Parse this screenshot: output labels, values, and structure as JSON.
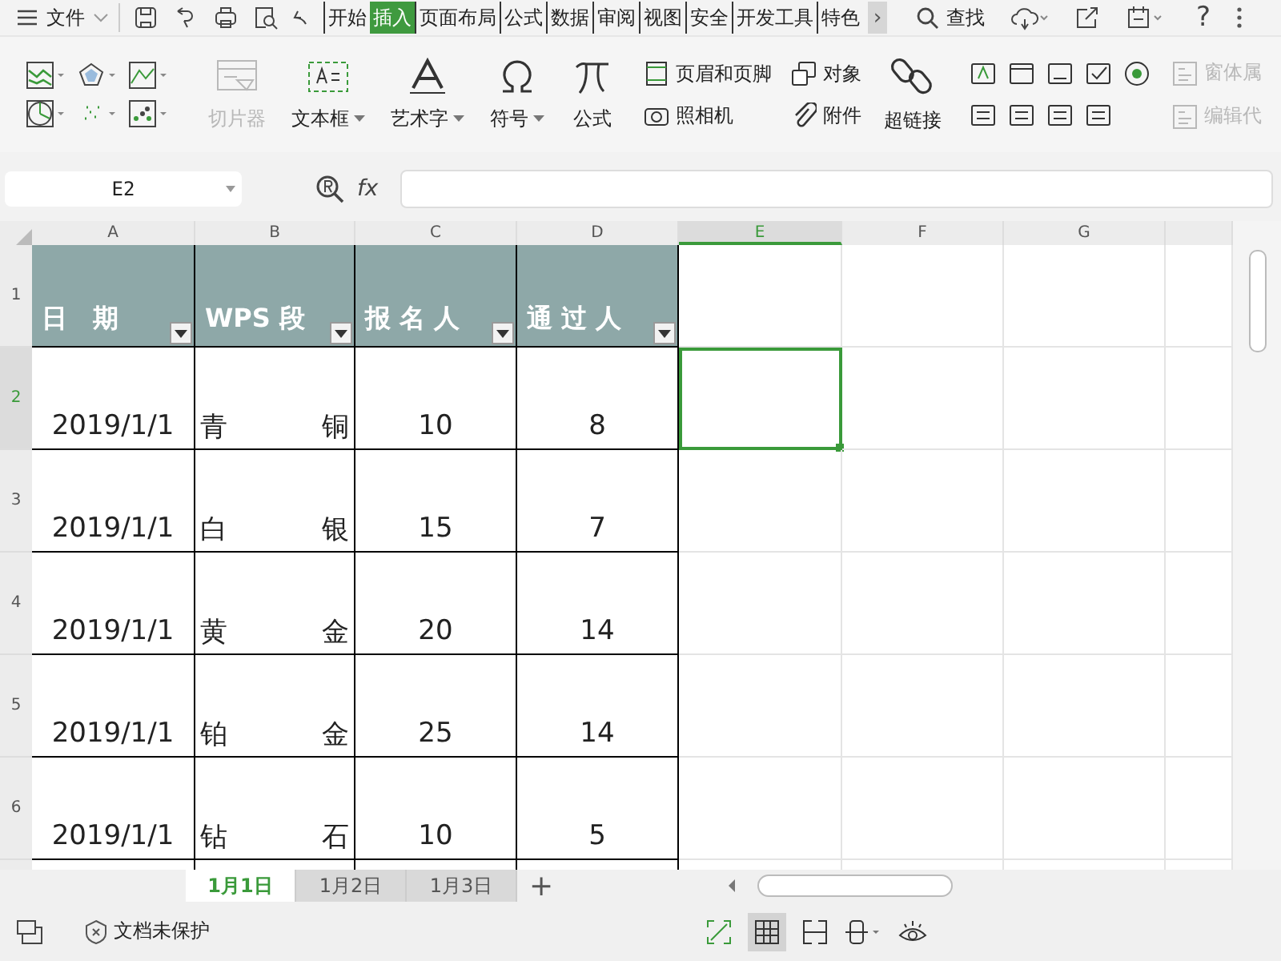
{
  "menu_bar": {
    "file_menu": "文件",
    "tabs": [
      {
        "label": "开始",
        "selected": false
      },
      {
        "label": "插入",
        "selected": true
      },
      {
        "label": "页面布局",
        "selected": false
      },
      {
        "label": "公式",
        "selected": false
      },
      {
        "label": "数据",
        "selected": false
      },
      {
        "label": "审阅",
        "selected": false
      },
      {
        "label": "视图",
        "selected": false
      },
      {
        "label": "安全",
        "selected": false
      },
      {
        "label": "开发工具",
        "selected": false
      },
      {
        "label": "特色",
        "selected": false
      }
    ],
    "more": "›",
    "search": "查找",
    "help": "?"
  },
  "ribbon": {
    "slicer": {
      "label": "切片器",
      "disabled": true
    },
    "insert_buttons": [
      {
        "label": "文本框",
        "dropdown": true
      },
      {
        "label": "艺术字",
        "dropdown": true
      },
      {
        "label": "符号",
        "dropdown": true
      },
      {
        "label": "公式",
        "dropdown": false
      }
    ],
    "small_buttons": [
      {
        "label": "页眉和页脚"
      },
      {
        "label": "照相机"
      },
      {
        "label": "对象"
      },
      {
        "label": "附件"
      }
    ],
    "hyperlink": "超链接",
    "control_buttons": [
      {
        "label": "窗体属",
        "disabled": true
      },
      {
        "label": "编辑代",
        "disabled": true
      }
    ]
  },
  "formula_bar": {
    "name_box": "E2",
    "function_label": "fx"
  },
  "sheet": {
    "columns": [
      {
        "label": "A",
        "selected": false
      },
      {
        "label": "B",
        "selected": false
      },
      {
        "label": "C",
        "selected": false
      },
      {
        "label": "D",
        "selected": false
      },
      {
        "label": "E",
        "selected": true
      },
      {
        "label": "F",
        "selected": false
      },
      {
        "label": "G",
        "selected": false
      }
    ],
    "rows": [
      {
        "number": "1",
        "selected": false,
        "cells": [
          {
            "text": "日　期",
            "filter": true
          },
          {
            "text": "WPS 段",
            "filter": true
          },
          {
            "text": "报 名 人",
            "filter": true
          },
          {
            "text": "通 过 人",
            "filter": true
          }
        ]
      },
      {
        "number": "2",
        "selected": true,
        "cells": [
          {
            "text": "2019/1/1",
            "filter": false
          },
          {
            "text": "青 铜",
            "filter": false
          },
          {
            "text": "10",
            "filter": false
          },
          {
            "text": "8",
            "filter": false
          }
        ]
      },
      {
        "number": "3",
        "selected": false,
        "cells": [
          {
            "text": "2019/1/1",
            "filter": false
          },
          {
            "text": "白 银",
            "filter": false
          },
          {
            "text": "15",
            "filter": false
          },
          {
            "text": "7",
            "filter": false
          }
        ]
      },
      {
        "number": "4",
        "selected": false,
        "cells": [
          {
            "text": "2019/1/1",
            "filter": false
          },
          {
            "text": "黄 金",
            "filter": false
          },
          {
            "text": "20",
            "filter": false
          },
          {
            "text": "14",
            "filter": false
          }
        ]
      },
      {
        "number": "5",
        "selected": false,
        "cells": [
          {
            "text": "2019/1/1",
            "filter": false
          },
          {
            "text": "铂 金",
            "filter": false
          },
          {
            "text": "25",
            "filter": false
          },
          {
            "text": "14",
            "filter": false
          }
        ]
      },
      {
        "number": "6",
        "selected": false,
        "cells": [
          {
            "text": "2019/1/1",
            "filter": false
          },
          {
            "text": "钻 石",
            "filter": false
          },
          {
            "text": "10",
            "filter": false
          },
          {
            "text": "5",
            "filter": false
          }
        ]
      }
    ]
  },
  "sheet_tabs": [
    {
      "label": "1月1日",
      "selected": true
    },
    {
      "label": "1月2日",
      "selected": false
    },
    {
      "label": "1月3日",
      "selected": false
    }
  ],
  "add_sheet": "+",
  "status_bar": {
    "protection": "文档未保护"
  }
}
